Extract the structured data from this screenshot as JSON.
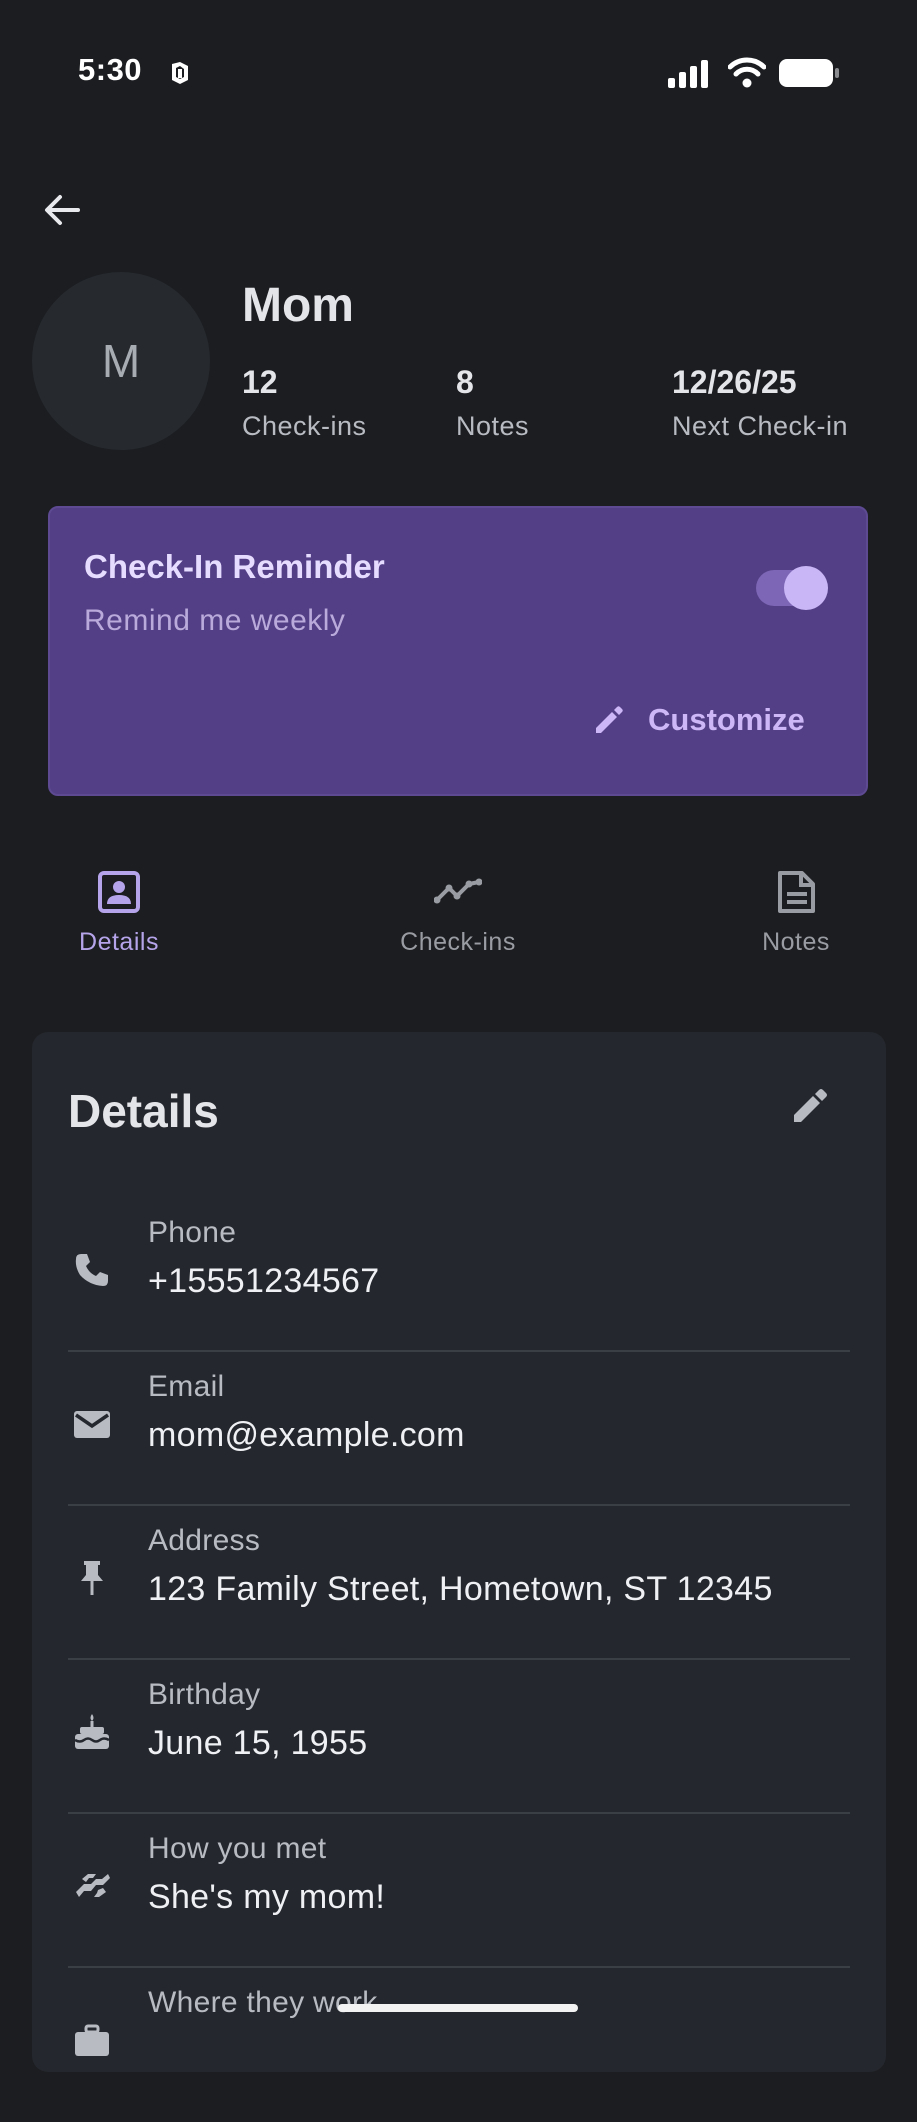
{
  "status_bar": {
    "time": "5:30"
  },
  "header": {
    "back_icon": "arrow-left-icon",
    "avatar_initial": "M",
    "name": "Mom",
    "stats": [
      {
        "value": "12",
        "label": "Check-ins"
      },
      {
        "value": "8",
        "label": "Notes"
      },
      {
        "value": "12/26/25",
        "label": "Next Check-in"
      }
    ]
  },
  "reminder": {
    "title": "Check-In Reminder",
    "subtitle": "Remind me weekly",
    "enabled": true,
    "customize_label": "Customize",
    "customize_icon": "pencil-icon"
  },
  "tabs": [
    {
      "label": "Details",
      "icon": "contact-card-icon",
      "active": true
    },
    {
      "label": "Check-ins",
      "icon": "trend-line-icon",
      "active": false
    },
    {
      "label": "Notes",
      "icon": "document-icon",
      "active": false
    }
  ],
  "details": {
    "title": "Details",
    "edit_icon": "pencil-icon",
    "rows": [
      {
        "icon": "phone-icon",
        "label": "Phone",
        "value": "+15551234567"
      },
      {
        "icon": "email-icon",
        "label": "Email",
        "value": "mom@example.com"
      },
      {
        "icon": "pin-icon",
        "label": "Address",
        "value": "123 Family Street, Hometown, ST 12345"
      },
      {
        "icon": "cake-icon",
        "label": "Birthday",
        "value": "June 15, 1955"
      },
      {
        "icon": "handshake-icon",
        "label": "How you met",
        "value": "She's my mom!"
      },
      {
        "icon": "briefcase-icon",
        "label": "Where they work",
        "value": ""
      }
    ]
  },
  "colors": {
    "background": "#1b1d20",
    "card": "#24272d",
    "reminder_card": "#523f85",
    "accent": "#b6a4ea"
  }
}
